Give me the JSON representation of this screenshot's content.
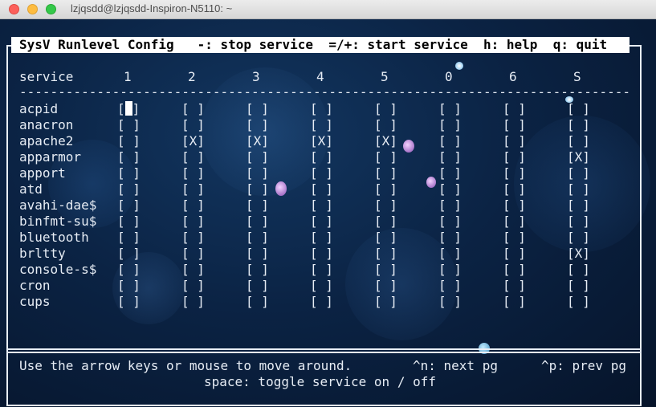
{
  "window": {
    "title": "lzjqsdd@lzjqsdd-Inspiron-N5110: ~"
  },
  "header": {
    "title": "SysV Runlevel Config",
    "stop_hint": "-: stop service",
    "start_hint": "=/+: start service",
    "help_hint": "h: help",
    "quit_hint": "q: quit"
  },
  "columns": [
    "service",
    "1",
    "2",
    "3",
    "4",
    "5",
    "0",
    "6",
    "S"
  ],
  "divider": "------------------------------------------------------------------------------------------------",
  "services": [
    {
      "name": "acpid",
      "states": [
        " ",
        " ",
        " ",
        " ",
        " ",
        " ",
        " ",
        " "
      ]
    },
    {
      "name": "anacron",
      "states": [
        " ",
        " ",
        " ",
        " ",
        " ",
        " ",
        " ",
        " "
      ]
    },
    {
      "name": "apache2",
      "states": [
        " ",
        "X",
        "X",
        "X",
        "X",
        " ",
        " ",
        " "
      ]
    },
    {
      "name": "apparmor",
      "states": [
        " ",
        " ",
        " ",
        " ",
        " ",
        " ",
        " ",
        "X"
      ]
    },
    {
      "name": "apport",
      "states": [
        " ",
        " ",
        " ",
        " ",
        " ",
        " ",
        " ",
        " "
      ]
    },
    {
      "name": "atd",
      "states": [
        " ",
        " ",
        " ",
        " ",
        " ",
        " ",
        " ",
        " "
      ]
    },
    {
      "name": "avahi-dae$",
      "states": [
        " ",
        " ",
        " ",
        " ",
        " ",
        " ",
        " ",
        " "
      ]
    },
    {
      "name": "binfmt-su$",
      "states": [
        " ",
        " ",
        " ",
        " ",
        " ",
        " ",
        " ",
        " "
      ]
    },
    {
      "name": "bluetooth",
      "states": [
        " ",
        " ",
        " ",
        " ",
        " ",
        " ",
        " ",
        " "
      ]
    },
    {
      "name": "brltty",
      "states": [
        " ",
        " ",
        " ",
        " ",
        " ",
        " ",
        " ",
        "X"
      ]
    },
    {
      "name": "console-s$",
      "states": [
        " ",
        " ",
        " ",
        " ",
        " ",
        " ",
        " ",
        " "
      ]
    },
    {
      "name": "cron",
      "states": [
        " ",
        " ",
        " ",
        " ",
        " ",
        " ",
        " ",
        " "
      ]
    },
    {
      "name": "cups",
      "states": [
        " ",
        " ",
        " ",
        " ",
        " ",
        " ",
        " ",
        " "
      ]
    }
  ],
  "cursor": {
    "row": 0,
    "col": 0
  },
  "footer": {
    "instructions": "Use the arrow keys or mouse to move around.",
    "next_page": "^n: next pg",
    "prev_page": "^p: prev pg",
    "toggle_hint": "space: toggle service on / off"
  }
}
